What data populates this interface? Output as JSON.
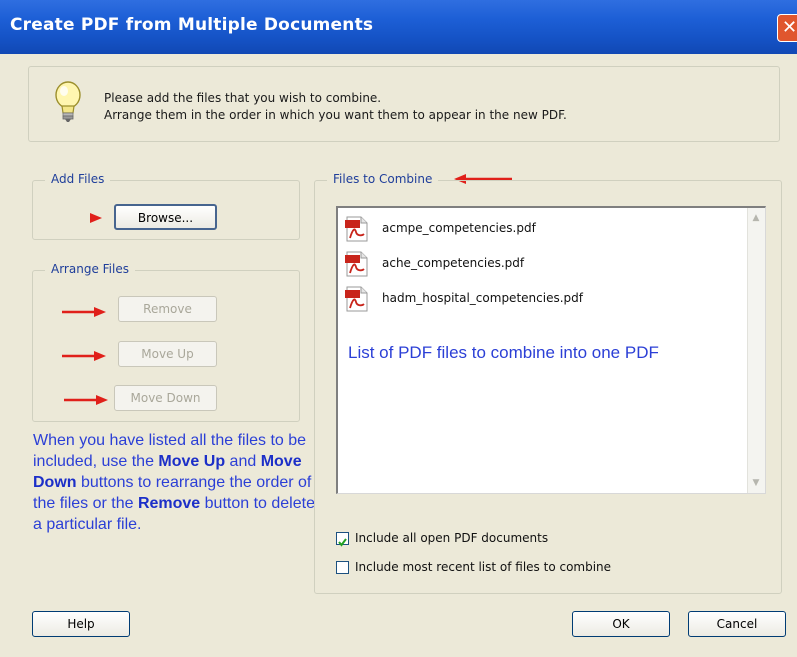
{
  "window": {
    "title": "Create PDF from Multiple Documents",
    "close_label": "✕"
  },
  "info": {
    "line1": "Please add the files that you wish to combine.",
    "line2": "Arrange them in the order in which you want them to appear in the new PDF."
  },
  "add_files": {
    "label": "Add Files",
    "browse_label": "Browse..."
  },
  "arrange_files": {
    "label": "Arrange Files",
    "remove_label": "Remove",
    "move_up_label": "Move Up",
    "move_down_label": "Move Down"
  },
  "annotation": {
    "explain_part1": "When you have listed all the files to be included, use the ",
    "move_up": "Move Up",
    "and": " and ",
    "move_down": "Move Down",
    "explain_part2": " buttons to rearrange the order of the files or the ",
    "remove": "Remove",
    "explain_part3": " button to delete a particular file.",
    "list_note": "List of PDF files to combine into one PDF"
  },
  "files_to_combine": {
    "label": "Files to Combine",
    "files": [
      "acmpe_competencies.pdf",
      "ache_competencies.pdf",
      "hadm_hospital_competencies.pdf"
    ],
    "include_open_label": "Include all open PDF documents",
    "include_open_checked": true,
    "include_recent_label": "Include most recent list of files to combine",
    "include_recent_checked": false
  },
  "footer": {
    "help_label": "Help",
    "ok_label": "OK",
    "cancel_label": "Cancel"
  },
  "colors": {
    "title_bar": "#1d5fd6",
    "annotation_text": "#2b3fd6",
    "arrow": "#e0201a",
    "dialog_bg": "#ece9d8"
  }
}
